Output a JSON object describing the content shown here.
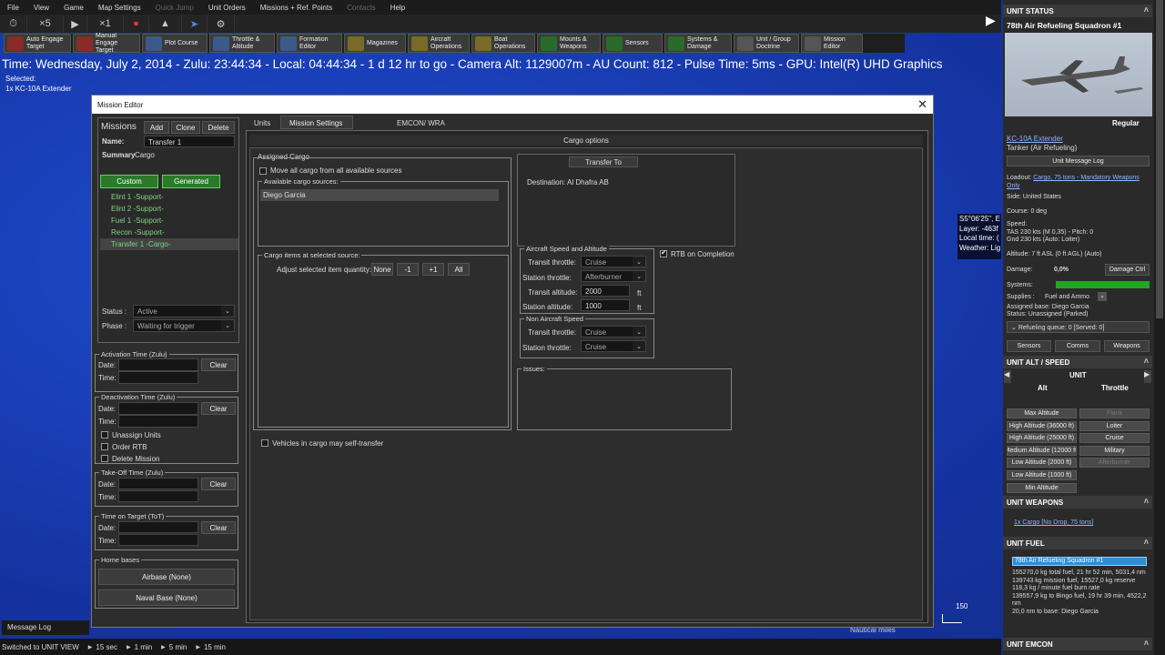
{
  "menu": [
    "File",
    "View",
    "Game",
    "Map Settings",
    "Quick Jump",
    "Unit Orders",
    "Missions + Ref. Points",
    "Contacts",
    "Help"
  ],
  "menu_disabled": [
    "Quick Jump",
    "Contacts"
  ],
  "toolbar1": {
    "speed1": "×5",
    "speed2": "×1"
  },
  "toolbar2": [
    {
      "label": "Auto Engage\nTarget",
      "color": "#8b2a2a"
    },
    {
      "label": "Manual\nEngage Target",
      "color": "#8b2a2a"
    },
    {
      "label": "Plot Course",
      "color": "#3a5a8a"
    },
    {
      "label": "Throttle &\nAltitude",
      "color": "#3a5a8a"
    },
    {
      "label": "Formation\nEditor",
      "color": "#3a5a8a"
    },
    {
      "label": "Magazines",
      "color": "#7a6a2a"
    },
    {
      "label": "Aircraft\nOperations",
      "color": "#7a6a2a"
    },
    {
      "label": "Boat\nOperations",
      "color": "#7a6a2a"
    },
    {
      "label": "Mounts &\nWeapons",
      "color": "#2a6a2a"
    },
    {
      "label": "Sensors",
      "color": "#2a6a2a"
    },
    {
      "label": "Systems &\nDamage",
      "color": "#2a6a2a"
    },
    {
      "label": "Unit / Group\nDoctrine",
      "color": "#555555"
    },
    {
      "label": "Mission\nEditor",
      "color": "#555555"
    }
  ],
  "status_line": "Time: Wednesday, July 2, 2014 - Zulu: 23:44:34 - Local: 04:44:34 - 1 d 12 hr to go -  Camera Alt: 1129007m  - AU Count: 812 - Pulse Time: 5ms - GPU: Intel(R) UHD Graphics",
  "selected": {
    "label": "Selected:",
    "unit": "1x KC-10A Extender"
  },
  "map_info": [
    "S5°06'25\", E",
    "Layer: -463f",
    "Local time: (",
    "Weather: Lig"
  ],
  "scale": {
    "value": "150",
    "unit": "Nautical miles"
  },
  "message_log": "Message Log",
  "bottom_bar": {
    "mode": "Switched to UNIT VIEW",
    "steps": [
      "15 sec",
      "1 min",
      "5 min",
      "15 min"
    ]
  },
  "editor": {
    "title": "Mission Editor",
    "missions_label": "Missions",
    "add": "Add",
    "clone": "Clone",
    "delete": "Delete",
    "name_label": "Name:",
    "name_value": "Transfer 1",
    "summary_label": "Summary",
    "summary_value": "Cargo",
    "custom": "Custom",
    "generated": "Generated",
    "missions": [
      "Elint 1 -Support-",
      "Elint 2 -Support-",
      "Fuel 1 -Support-",
      "Recon -Support-",
      "Transfer 1 -Cargo-"
    ],
    "status_label": "Status :",
    "status_value": "Active",
    "phase_label": "Phase :",
    "phase_value": "Waiting for trigger",
    "activation": "Activation Time (Zulu)",
    "deactivation": "Deactivation Time (Zulu)",
    "takeoff": "Take-Off Time (Zulu)",
    "tot": "Time on Target (ToT)",
    "date": "Date:",
    "time": "Time:",
    "clear": "Clear",
    "unassign": "Unassign Units",
    "order_rtb": "Order RTB",
    "delete_mission": "Delete Mission",
    "home_bases": "Home bases",
    "airbase": "Airbase (None)",
    "naval_base": "Naval Base (None)",
    "tabs": [
      "Units",
      "Mission Settings",
      "EMCON/ WRA"
    ],
    "cargo_options": "Cargo options",
    "assigned_cargo": "Assigned Cargo",
    "move_all": "Move all cargo from all available sources",
    "available_sources": "Available cargo sources:",
    "source_item": "Diego Garcia",
    "cargo_items": "Cargo items at selected source:",
    "adjust_qty": "Adjust selected item quantity:",
    "qty_buttons": [
      "None",
      "-1",
      "+1",
      "All"
    ],
    "vehicles_self": "Vehicles in cargo may self-transfer",
    "transfer_to": "Transfer To",
    "destination": "Destination: Al Dhafra AB",
    "aircraft_speed_alt": "Aircraft Speed and Altitude",
    "transit_throttle": "Transit throttle:",
    "transit_throttle_value": "Cruise",
    "station_throttle": "Station throttle:",
    "station_throttle_value": "Afterburner",
    "transit_alt": "Transit altitude:",
    "transit_alt_value": "2000",
    "station_alt": "Station altitude:",
    "station_alt_value": "1000",
    "ft": "ft",
    "rtb_completion": "RTB on Completion",
    "non_aircraft_speed": "Non Aircraft Speed",
    "na_transit_value": "Cruise",
    "na_station_value": "Cruise",
    "issues": "Issues:"
  },
  "right": {
    "unit_status": "UNIT STATUS",
    "unit_name": "78th Air Refueling Squadron #1",
    "regular": "Regular",
    "aircraft": "KC-10A Extender",
    "role": "Tanker (Air Refueling)",
    "msg_log": "Unit Message Log",
    "loadout_label": "Loadout:",
    "loadout": "Cargo, 75 tons - Mandatory Weapons Only",
    "side": "Side: United States",
    "course": "Course: 0 deg",
    "speed": "Speed:",
    "tas": "TAS 230 kts (M 0,35) - Pitch: 0",
    "gnd": "Gnd 230 kts (Auto: Loiter)",
    "altitude": "Altitude: 7 ft ASL (0 ft AGL) (Auto)",
    "damage_label": "Damage:",
    "damage_value": "0,0%",
    "damage_ctrl": "Damage Ctrl",
    "systems": "Systems:",
    "supplies_label": "Supplies :",
    "supplies_value": "Fuel and Ammo",
    "assigned_base": "Assigned base: Diego Garcia",
    "status": "Status: Unassigned (Parked)",
    "refuel_queue": "Refueling queue: 0 [Served: 0]",
    "tabs": [
      "Sensors",
      "Comms",
      "Weapons"
    ],
    "alt_speed": "UNIT ALT / SPEED",
    "unit": "UNIT",
    "alt": "Alt",
    "throttle": "Throttle",
    "alt_buttons": [
      "Max Altitude",
      "High Altitude (36000 ft)",
      "High Altitude (25000 ft)",
      "Medium Altitude (12000 ft)",
      "Low Altitude (2000 ft)",
      "Low Altitude (1000 ft)",
      "Min Altitude"
    ],
    "throttle_buttons": [
      "Flank",
      "Loiter",
      "Cruise",
      "Military",
      "Afterburner"
    ],
    "weapons": "UNIT WEAPONS",
    "weapon_item": "1x Cargo [No Drop, 75 tons]",
    "fuel": "UNIT FUEL",
    "fuel_sel": "78th Air Refueling Squadron #1",
    "fuel_lines": [
      "155270,0 kg total fuel, 21 hr 52 min, 5031,4 nm",
      "139743 kg mission fuel, 15527,0 kg reserve",
      "118,3 kg / minute fuel burn rate",
      "139557,9 kg to Bingo fuel, 19 hr 39 min, 4522,2 nm",
      "20,0 nm to base: Diego Garcia"
    ],
    "emcon": "UNIT EMCON"
  }
}
